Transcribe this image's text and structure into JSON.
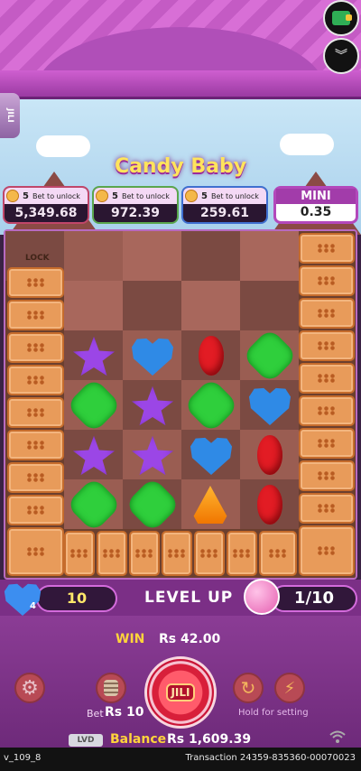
{
  "game_title": "Candy Baby",
  "brand_tab": "JILI",
  "jackpots": [
    {
      "unlock_count": "5",
      "unlock_text": "Bet to unlock",
      "value": "5,349.68"
    },
    {
      "unlock_count": "5",
      "unlock_text": "Bet to unlock",
      "value": "972.39"
    },
    {
      "unlock_count": "5",
      "unlock_text": "Bet to unlock",
      "value": "259.61"
    }
  ],
  "mini": {
    "label": "MINI",
    "value": "0.35"
  },
  "board": {
    "lock_label": "LOCK"
  },
  "level": {
    "heart_count": "4",
    "collected": "10",
    "label": "LEVEL UP",
    "progress": "1/10"
  },
  "win": {
    "label": "WIN",
    "value": "Rs 42.00"
  },
  "bet": {
    "label": "Bet",
    "value": "Rs 10"
  },
  "spin_logo": "JILI",
  "hold_text": "Hold for setting",
  "balance": {
    "badge": "LVD",
    "label": "Balance",
    "value": "Rs 1,609.39"
  },
  "footer": {
    "version": "v_109_8",
    "transaction": "Transaction 24359-835360-00070023"
  },
  "icons": [
    "wallet-icon",
    "chevron-down-icon",
    "settings-gear-icon",
    "bet-chips-icon",
    "auto-spin-icon",
    "turbo-icon",
    "wifi-icon"
  ],
  "colors": {
    "accent": "#d46bdc",
    "gold": "#ffd43b",
    "spin_red": "#d81f3a"
  }
}
